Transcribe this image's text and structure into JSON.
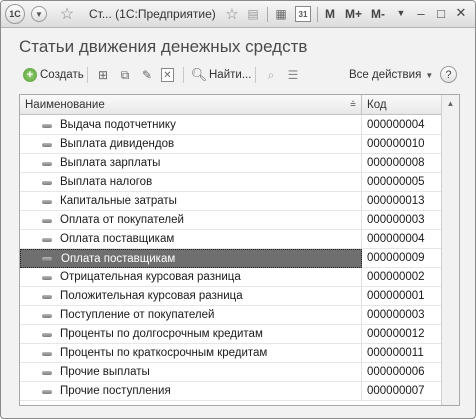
{
  "titlebar": {
    "logo": "1С",
    "title": "Ст...  (1С:Предприятие)",
    "m_label": "M",
    "mplus_label": "M+",
    "mminus_label": "M-",
    "calendar_day": "31"
  },
  "form": {
    "title": "Статьи движения денежных средств"
  },
  "commands": {
    "create": "Создать",
    "find": "Найти...",
    "all_actions": "Все действия",
    "help": "?"
  },
  "table": {
    "col_name": "Наименование",
    "col_code": "Код",
    "selected_index": 7,
    "rows": [
      {
        "name": "Выдача подотчетнику",
        "code": "000000004"
      },
      {
        "name": "Выплата дивидендов",
        "code": "000000010"
      },
      {
        "name": "Выплата зарплаты",
        "code": "000000008"
      },
      {
        "name": "Выплата налогов",
        "code": "000000005"
      },
      {
        "name": "Капитальные затраты",
        "code": "000000013"
      },
      {
        "name": "Оплата от покупателей",
        "code": "000000003"
      },
      {
        "name": "Оплата поставщикам",
        "code": "000000004"
      },
      {
        "name": "Оплата поставщикам",
        "code": "000000009"
      },
      {
        "name": "Отрицательная курсовая разница",
        "code": "000000002"
      },
      {
        "name": "Положительная курсовая разница",
        "code": "000000001"
      },
      {
        "name": "Поступление от покупателей",
        "code": "000000003"
      },
      {
        "name": "Проценты по долгосрочным кредитам",
        "code": "000000012"
      },
      {
        "name": "Проценты по краткосрочным кредитам",
        "code": "000000011"
      },
      {
        "name": "Прочие выплаты",
        "code": "000000006"
      },
      {
        "name": "Прочие поступления",
        "code": "000000007"
      }
    ]
  }
}
